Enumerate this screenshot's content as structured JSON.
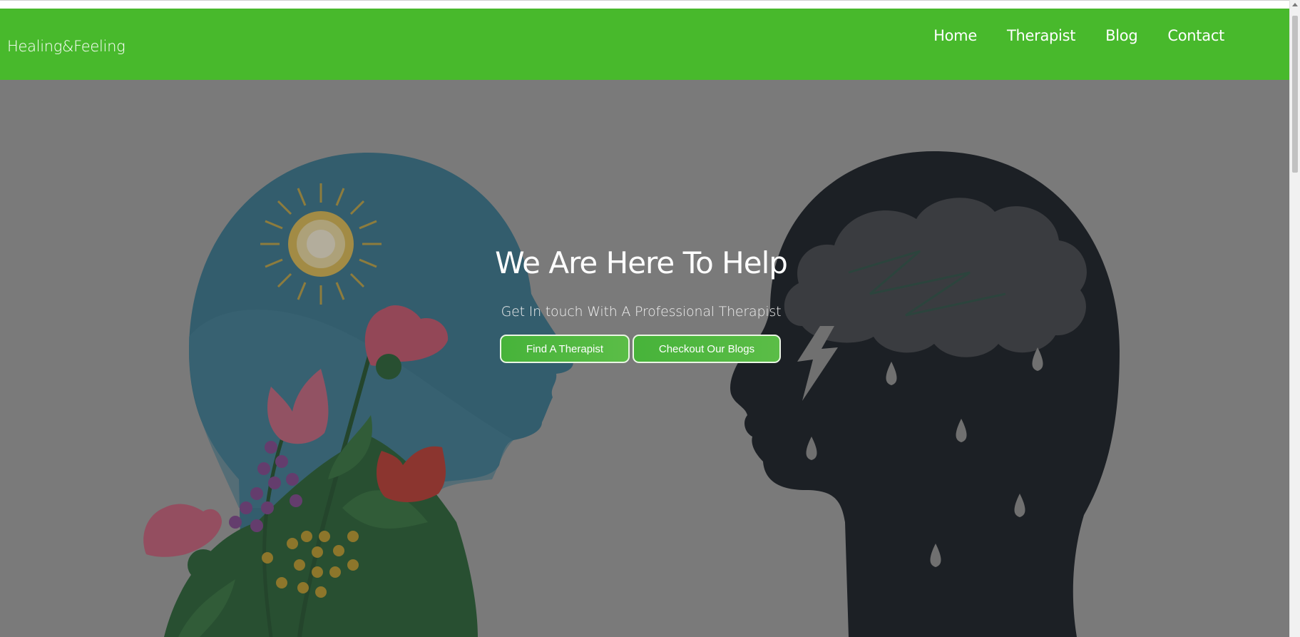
{
  "brand": "Healing&Feeling",
  "nav": {
    "home": "Home",
    "therapist": "Therapist",
    "blog": "Blog",
    "contact": "Contact"
  },
  "hero": {
    "title": "We Are Here To Help",
    "subtitle": "Get In touch With A Professional Therapist",
    "btn_therapist": "Find A Therapist",
    "btn_blogs": "Checkout Our Blogs"
  },
  "colors": {
    "navbar": "#48b92c",
    "button": "#4fb63e",
    "overlay": "#7f7f7f"
  },
  "icons": [
    "hopeful-head-illustration",
    "sun-icon",
    "flower-bouquet",
    "sad-head-illustration",
    "storm-cloud-icon",
    "lightning-icon",
    "raindrop-icon"
  ]
}
